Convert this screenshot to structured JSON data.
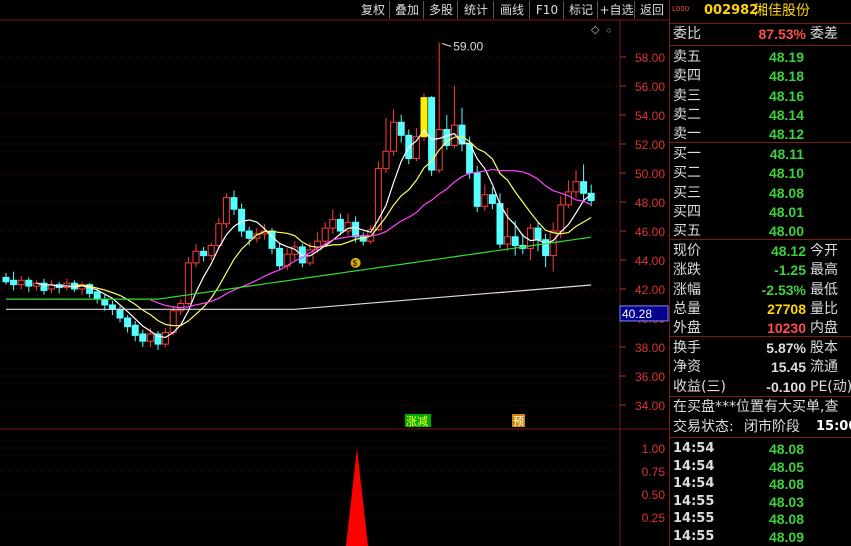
{
  "toolbar": [
    "复权",
    "叠加",
    "多股",
    "统计",
    "画线",
    "F10",
    "标记",
    "+自选",
    "返回"
  ],
  "stock": {
    "badge": "L000",
    "code": "002982",
    "name": "湘佳股份"
  },
  "wei": {
    "wb_label": "委比",
    "wb_value": "87.53%",
    "wc_label": "委差"
  },
  "sell": [
    {
      "label": "卖五",
      "price": "48.19"
    },
    {
      "label": "卖四",
      "price": "48.18"
    },
    {
      "label": "卖三",
      "price": "48.16"
    },
    {
      "label": "卖二",
      "price": "48.14"
    },
    {
      "label": "卖一",
      "price": "48.12"
    }
  ],
  "buy": [
    {
      "label": "买一",
      "price": "48.11"
    },
    {
      "label": "买二",
      "price": "48.10"
    },
    {
      "label": "买三",
      "price": "48.08"
    },
    {
      "label": "买四",
      "price": "48.01"
    },
    {
      "label": "买五",
      "price": "48.00"
    }
  ],
  "quote": [
    {
      "l": "现价",
      "v": "48.12",
      "c": "green",
      "r": "今开"
    },
    {
      "l": "涨跌",
      "v": "-1.25",
      "c": "green",
      "r": "最高"
    },
    {
      "l": "涨幅",
      "v": "-2.53%",
      "c": "green",
      "r": "最低"
    },
    {
      "l": "总量",
      "v": "27708",
      "c": "yel",
      "r": "量比"
    },
    {
      "l": "外盘",
      "v": "10230",
      "c": "red",
      "r": "内盘"
    }
  ],
  "quote2": [
    {
      "l": "换手",
      "v": "5.87%",
      "r": "股本"
    },
    {
      "l": "净资",
      "v": "15.45",
      "r": "流通"
    },
    {
      "l": "收益(三)",
      "v": "-0.100",
      "r": "PE(动)"
    }
  ],
  "notice": "在买盘***位置有大买单,查",
  "status": {
    "label": "交易状态:",
    "value": "闭市阶段",
    "time": "15:00:"
  },
  "ticks": [
    {
      "t": "14:54",
      "p": "48.08"
    },
    {
      "t": "14:54",
      "p": "48.05"
    },
    {
      "t": "14:54",
      "p": "48.08"
    },
    {
      "t": "14:55",
      "p": "48.03"
    },
    {
      "t": "14:55",
      "p": "48.08"
    },
    {
      "t": "14:55",
      "p": "48.09"
    }
  ],
  "axis": {
    "price_ticks": [
      "58.00",
      "56.00",
      "54.00",
      "52.00",
      "50.00",
      "48.00",
      "46.00",
      "44.00",
      "42.00",
      "40.00",
      "38.00",
      "36.00",
      "34.00"
    ],
    "crosshair_price": "40.28",
    "high_label": "59.00",
    "ind_ticks": [
      "1.00",
      "0.75",
      "0.50",
      "0.25"
    ]
  },
  "markers": {
    "zhangjian": "涨减",
    "yu": "预"
  }
}
